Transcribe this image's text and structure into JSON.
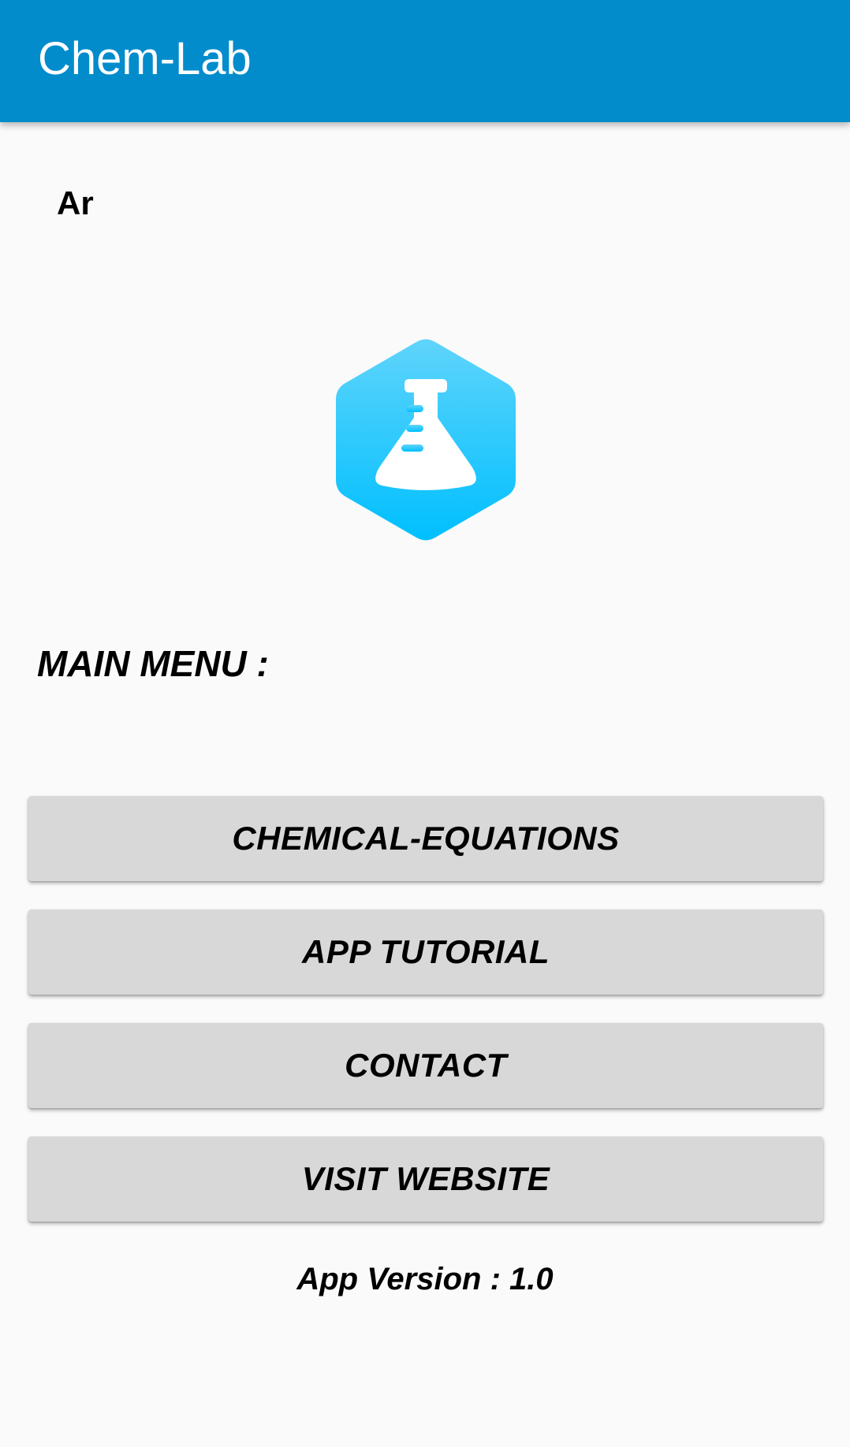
{
  "appbar": {
    "title": "Chem-Lab",
    "color": "#038ccc"
  },
  "element": {
    "symbol": "Ar"
  },
  "logo": {
    "icon": "flask-hexagon-icon",
    "gradient_top": "#5fd4fb",
    "gradient_bottom": "#00bfff"
  },
  "menu": {
    "heading": "MAIN MENU :",
    "buttons": [
      {
        "label": "CHEMICAL-EQUATIONS"
      },
      {
        "label": "APP TUTORIAL"
      },
      {
        "label": "CONTACT"
      },
      {
        "label": "VISIT WEBSITE"
      }
    ]
  },
  "footer": {
    "version_text": "App Version : 1.0"
  }
}
